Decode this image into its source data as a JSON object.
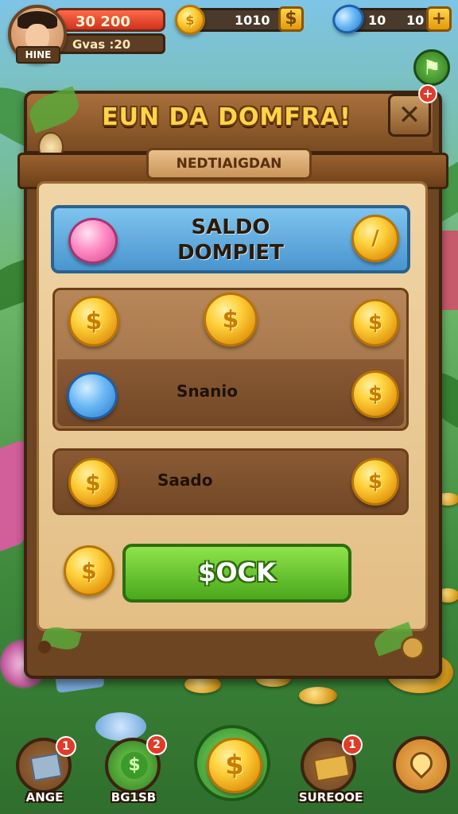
{
  "hud": {
    "player_name": "HINE",
    "health_value": "30 200",
    "sub_label": "Gvas :20",
    "coins_value": "1010",
    "gems_left": "10",
    "gems_right": "10"
  },
  "panel": {
    "title": "EUN DA DOMFRA!",
    "subtitle": "NEDTIAIGDAN",
    "featured_line1": "SALDO",
    "featured_line2": "DOMPIET",
    "row2_label": "Snanio",
    "row3_label": "Saado",
    "action_button": "$OCK"
  },
  "bottom_nav": [
    {
      "label": "ANGE",
      "badge": "1"
    },
    {
      "label": "BG1SB",
      "badge": "2"
    },
    {
      "label": "SUREOOE",
      "badge": "1"
    }
  ],
  "colors": {
    "title_gold": "#ffd44a",
    "action_green": "#4aa81c",
    "badge_red": "#e23a2a"
  }
}
